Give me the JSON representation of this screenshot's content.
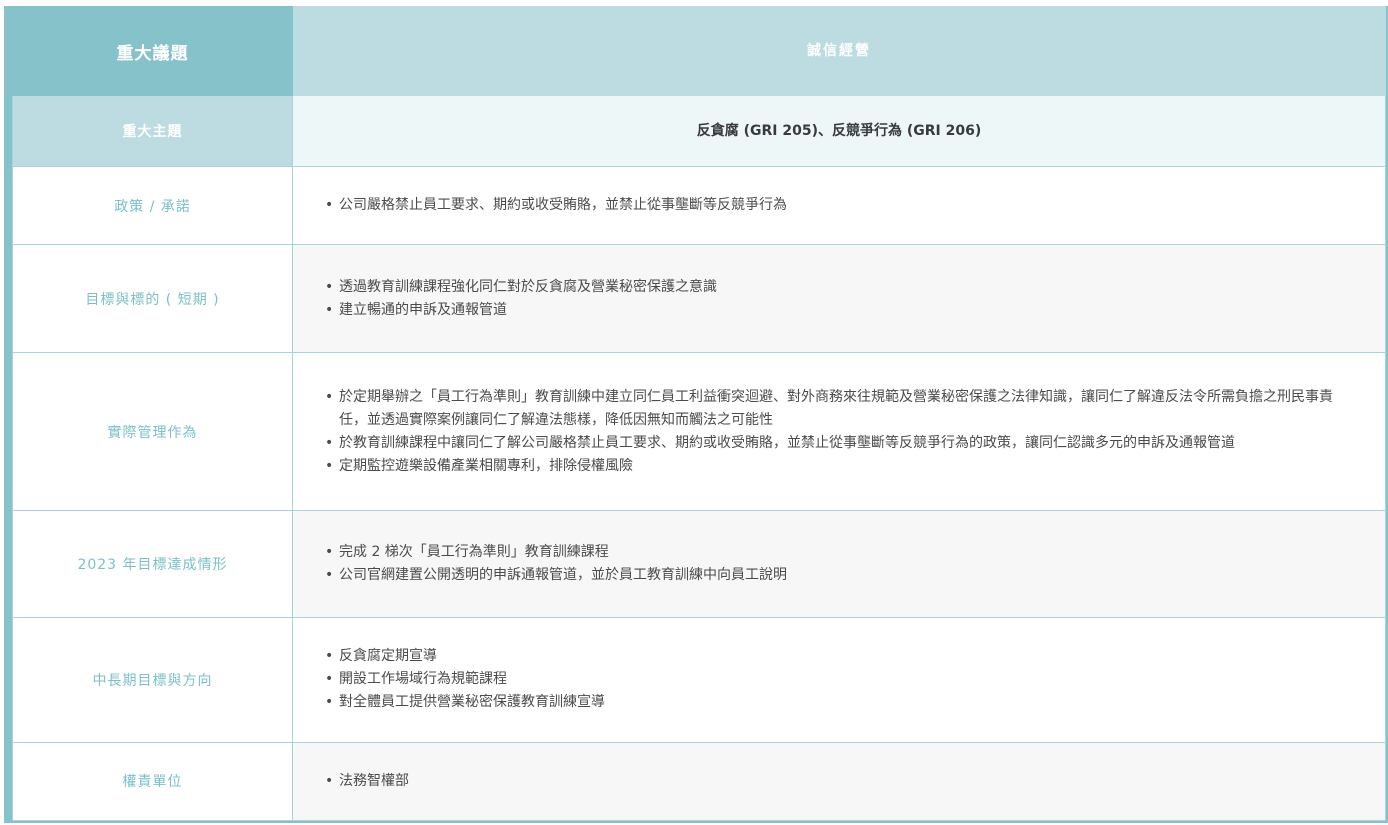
{
  "header": {
    "issue_label": "重大議題",
    "issue_value": "誠信經營"
  },
  "topic": {
    "label": "重大主題",
    "value": "反貪腐 (GRI 205)、反競爭行為 (GRI 206)"
  },
  "rows": [
    {
      "label": "政策 / 承諾",
      "items": [
        "公司嚴格禁止員工要求、期約或收受賄賂，並禁止從事壟斷等反競爭行為"
      ]
    },
    {
      "label": "目標與標的 ( 短期 )",
      "items": [
        "透過教育訓練課程強化同仁對於反貪腐及營業秘密保護之意識",
        "建立暢通的申訴及通報管道"
      ]
    },
    {
      "label": "實際管理作為",
      "items": [
        "於定期舉辦之「員工行為準則」教育訓練中建立同仁員工利益衝突迴避、對外商務來往規範及營業秘密保護之法律知識，讓同仁了解違反法令所需負擔之刑民事責任，並透過實際案例讓同仁了解違法態樣，降低因無知而觸法之可能性",
        "於教育訓練課程中讓同仁了解公司嚴格禁止員工要求、期約或收受賄賂，並禁止從事壟斷等反競爭行為的政策，讓同仁認識多元的申訴及通報管道",
        "定期監控遊樂設備產業相關專利，排除侵權風險"
      ]
    },
    {
      "label": "2023 年目標達成情形",
      "items": [
        "完成 2 梯次「員工行為準則」教育訓練課程",
        "公司官網建置公開透明的申訴通報管道，並於員工教育訓練中向員工說明"
      ]
    },
    {
      "label": "中長期目標與方向",
      "items": [
        "反貪腐定期宣導",
        "開設工作場域行為規範課程",
        "對全體員工提供營業秘密保護教育訓練宣導"
      ]
    },
    {
      "label": "權責單位",
      "items": [
        "法務智權部"
      ]
    }
  ]
}
